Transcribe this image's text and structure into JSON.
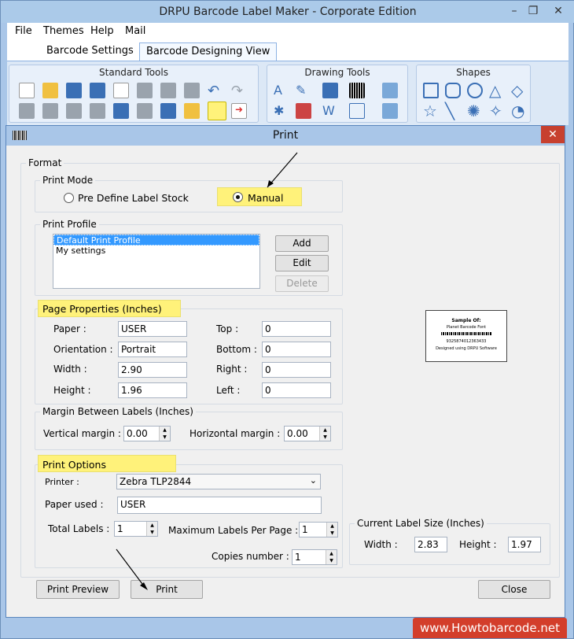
{
  "app_title": "DRPU Barcode Label Maker - Corporate Edition",
  "window_controls": {
    "minimize": "–",
    "restore": "❐",
    "close": "✕"
  },
  "menu": [
    "File",
    "Themes",
    "Help",
    "Mail"
  ],
  "tabs": [
    {
      "label": "Barcode Settings"
    },
    {
      "label": "Barcode Designing View"
    }
  ],
  "ribbon": {
    "groups": [
      {
        "label": "Standard Tools"
      },
      {
        "label": "Drawing Tools"
      },
      {
        "label": "Shapes"
      }
    ],
    "colors": {
      "ribbon_bg": "#dce8f6",
      "icon_blue": "#3a6fb5",
      "icon_gray": "#9aa3ad",
      "icon_yellow": "#f0c040",
      "highlight": "#fff27a"
    }
  },
  "dialog": {
    "title": "Print",
    "close": "✕",
    "format_legend": "Format",
    "print_mode": {
      "legend": "Print Mode",
      "option_predefine": "Pre Define Label Stock",
      "option_manual": "Manual",
      "selected": "Manual"
    },
    "print_profile": {
      "legend": "Print Profile",
      "items": [
        "Default Print Profile",
        "My settings"
      ],
      "selected_index": 0,
      "add": "Add",
      "edit": "Edit",
      "delete": "Delete"
    },
    "page_properties": {
      "legend": "Page Properties (Inches)",
      "paper_label": "Paper :",
      "paper_value": "USER",
      "orientation_label": "Orientation :",
      "orientation_value": "Portrait",
      "width_label": "Width :",
      "width_value": "2.90",
      "height_label": "Height :",
      "height_value": "1.96",
      "top_label": "Top :",
      "top_value": "0",
      "bottom_label": "Bottom :",
      "bottom_value": "0",
      "right_label": "Right :",
      "right_value": "0",
      "left_label": "Left :",
      "left_value": "0"
    },
    "margin": {
      "legend": "Margin Between Labels (Inches)",
      "vertical_label": "Vertical margin :",
      "vertical_value": "0.00",
      "horizontal_label": "Horizontal margin :",
      "horizontal_value": "0.00"
    },
    "print_options": {
      "legend": "Print Options",
      "printer_label": "Printer :",
      "printer_value": "Zebra TLP2844",
      "paper_used_label": "Paper used :",
      "paper_used_value": "USER",
      "total_labels_label": "Total Labels :",
      "total_labels_value": "1",
      "max_labels_label": "Maximum Labels Per Page :",
      "max_labels_value": "1",
      "copies_label": "Copies number :",
      "copies_value": "1"
    },
    "preview": {
      "line1": "Sample Of:",
      "line2": "Planet Barcode Font",
      "line3": "9325874012363433",
      "line4": "Designed using DRPU Software"
    },
    "current_label_size": {
      "legend": "Current Label Size (Inches)",
      "width_label": "Width :",
      "width_value": "2.83",
      "height_label": "Height :",
      "height_value": "1.97"
    },
    "buttons": {
      "print_preview": "Print Preview",
      "print": "Print",
      "close": "Close"
    }
  },
  "footer": "www.Howtobarcode.net"
}
